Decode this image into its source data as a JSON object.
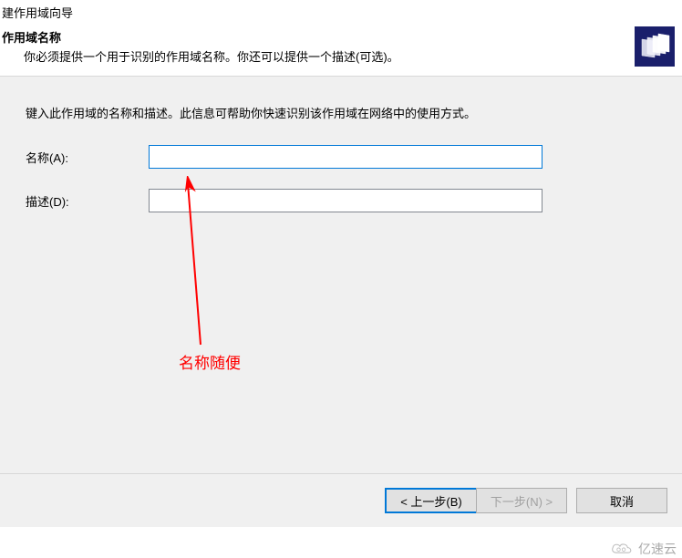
{
  "wizard": {
    "top_title": "建作用域向导"
  },
  "header": {
    "title": "作用域名称",
    "subtitle": "你必须提供一个用于识别的作用域名称。你还可以提供一个描述(可选)。"
  },
  "main": {
    "instruction": "键入此作用域的名称和描述。此信息可帮助你快速识别该作用域在网络中的使用方式。",
    "name_label": "名称(A):",
    "name_value": "",
    "desc_label": "描述(D):",
    "desc_value": ""
  },
  "annotation": {
    "text": "名称随便"
  },
  "buttons": {
    "back": "< 上一步(B)",
    "next": "下一步(N) >",
    "cancel": "取消"
  },
  "watermark": {
    "text": "亿速云"
  }
}
